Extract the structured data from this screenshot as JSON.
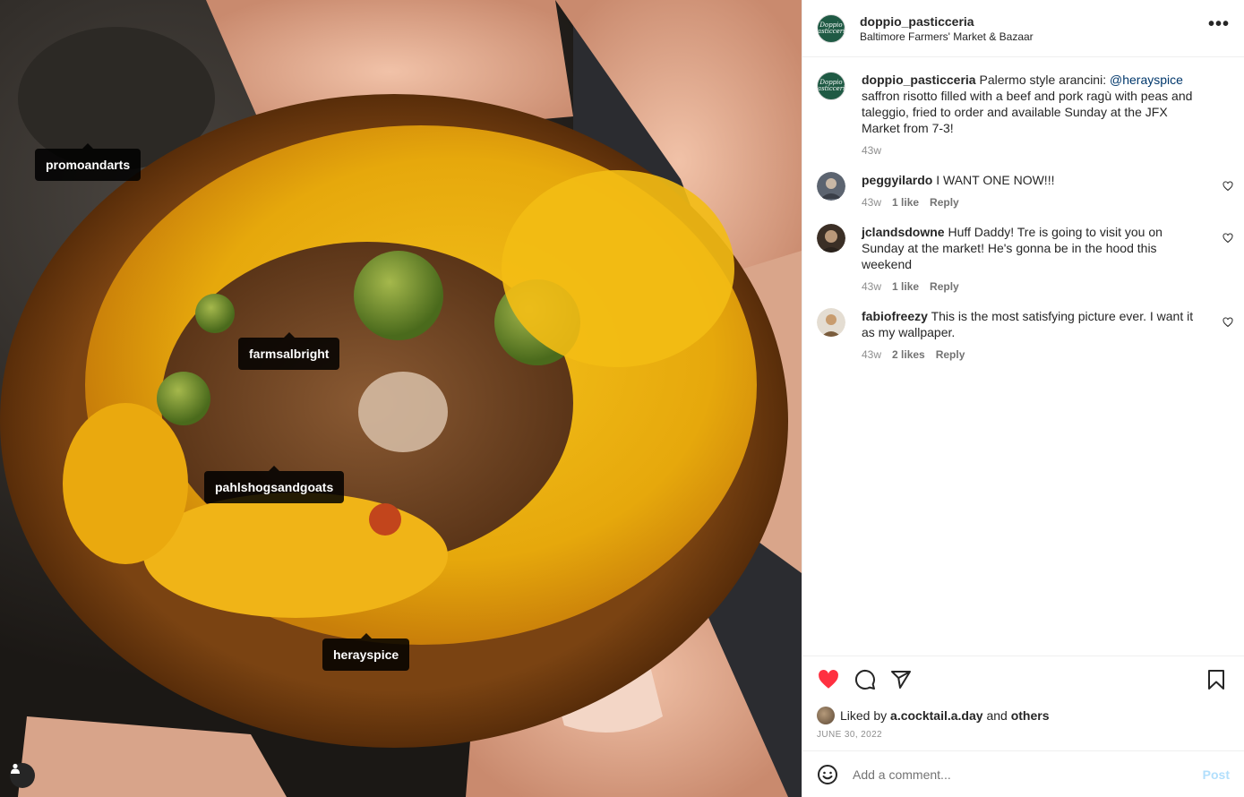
{
  "photo": {
    "tags": [
      "promoandarts",
      "farmsalbright",
      "pahlshogsandgoats",
      "herayspice"
    ],
    "user_tags_icon": "person-icon"
  },
  "header": {
    "username": "doppio_pasticceria",
    "location": "Baltimore Farmers' Market & Bazaar",
    "avatar_text": "Doppio Pasticceria",
    "more_label": "•••"
  },
  "caption": {
    "username": "doppio_pasticceria",
    "text_before": "Palermo style arancini: ",
    "mention": "@herayspice",
    "text_after": " saffron risotto filled with a beef and pork ragù with peas and taleggio, fried to order and available Sunday at the JFX Market from 7-3!",
    "time": "43w"
  },
  "comments": [
    {
      "username": "peggyilardo",
      "text": "I WANT ONE NOW!!!",
      "time": "43w",
      "likes": "1 like",
      "reply": "Reply"
    },
    {
      "username": "jclandsdowne",
      "text": "Huff Daddy! Tre is going to visit you on Sunday at the market! He's gonna be in the hood this weekend",
      "time": "43w",
      "likes": "1 like",
      "reply": "Reply"
    },
    {
      "username": "fabiofreezy",
      "text": "This is the most satisfying picture ever. I want it as my wallpaper.",
      "time": "43w",
      "likes": "2 likes",
      "reply": "Reply"
    }
  ],
  "actions": {
    "liked_prefix": "Liked by ",
    "liked_user": "a.cocktail.a.day",
    "liked_and": " and ",
    "liked_others": "others",
    "date": "JUNE 30, 2022"
  },
  "add_comment": {
    "placeholder": "Add a comment...",
    "post_label": "Post"
  },
  "colors": {
    "like_red": "#ff3040",
    "mention_blue": "#00376b",
    "post_disabled": "#b2dffc",
    "avatar_green": "#1f5a44"
  }
}
